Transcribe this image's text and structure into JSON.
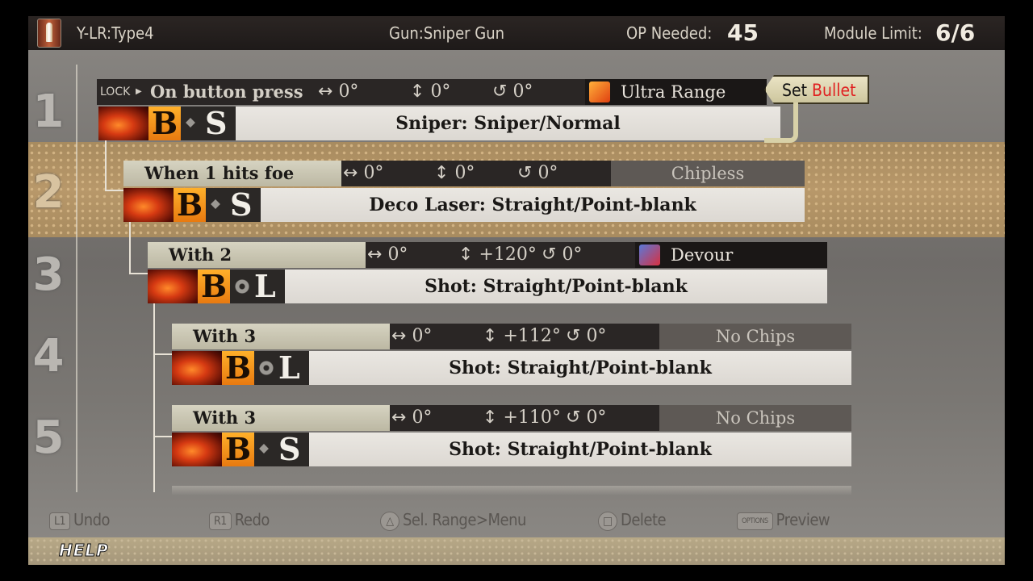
{
  "header": {
    "bullet_name": "Y-LR:Type4",
    "gun_label": "Gun:Sniper Gun",
    "op_label": "OP Needed:",
    "op_value": "45",
    "module_label": "Module  Limit:",
    "module_value": "6/6"
  },
  "rows": [
    {
      "num": "1",
      "lock_label": "LOCK",
      "trigger": "On button press",
      "h_angle": "0°",
      "v_angle": "0°",
      "r_angle": "0°",
      "chip": "Ultra Range",
      "type_letter": "S",
      "element": "B",
      "module": "Sniper: Sniper/Normal"
    },
    {
      "num": "2",
      "trigger": "When 1 hits foe",
      "h_angle": "0°",
      "v_angle": "0°",
      "r_angle": "0°",
      "chip": "Chipless",
      "type_letter": "S",
      "element": "B",
      "module": "Deco Laser: Straight/Point-blank"
    },
    {
      "num": "3",
      "trigger": "With 2",
      "h_angle": "0°",
      "v_angle": "+120°",
      "r_angle": "0°",
      "chip": "Devour",
      "type_letter": "L",
      "element": "B",
      "module": "Shot: Straight/Point-blank"
    },
    {
      "num": "4",
      "trigger": "With 3",
      "h_angle": "0°",
      "v_angle": "+112°",
      "r_angle": "0°",
      "chip": "No Chips",
      "type_letter": "L",
      "element": "B",
      "module": "Shot: Straight/Point-blank"
    },
    {
      "num": "5",
      "trigger": "With 3",
      "h_angle": "0°",
      "v_angle": "+110°",
      "r_angle": "0°",
      "chip": "No Chips",
      "type_letter": "S",
      "element": "B",
      "module": "Shot: Straight/Point-blank"
    }
  ],
  "set_bullet": {
    "prefix": "Set ",
    "highlight": "Bullet"
  },
  "controls": [
    {
      "button": "L1",
      "label": "Undo"
    },
    {
      "button": "R1",
      "label": "Redo"
    },
    {
      "button": "△",
      "label": "Sel. Range>Menu"
    },
    {
      "button": "□",
      "label": "Delete"
    },
    {
      "button": "OPTIONS",
      "label": "Preview"
    }
  ],
  "help": "HELP",
  "colors": {
    "accent_orange": "#e87a10",
    "chip_red": "#e02020",
    "band_gold": "#b8986a"
  }
}
